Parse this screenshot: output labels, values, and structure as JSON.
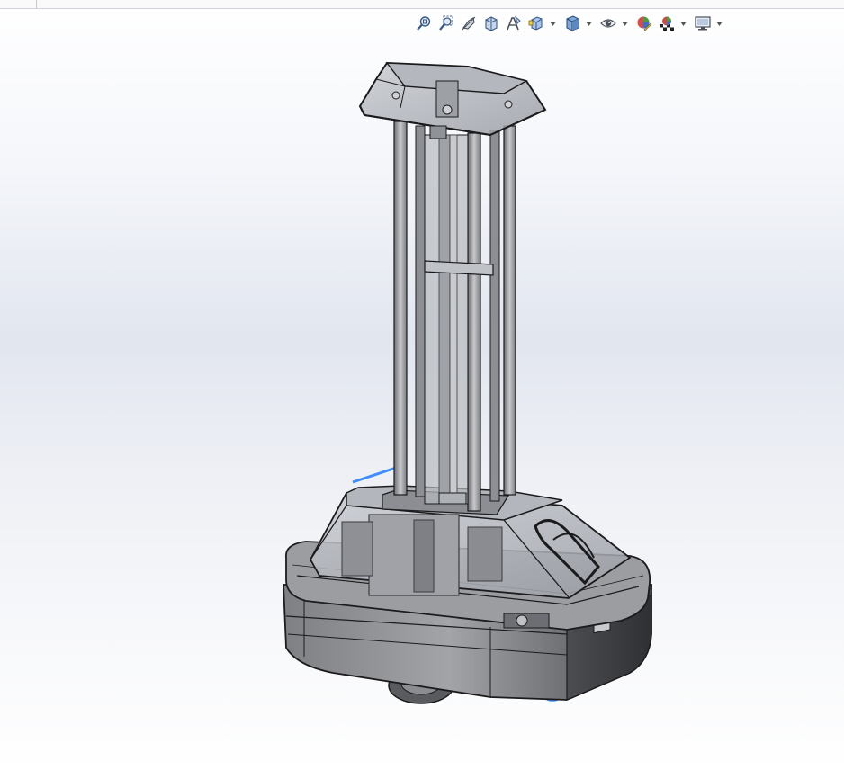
{
  "heads_up_toolbar": {
    "buttons": [
      {
        "icon": "zoom-to-fit-icon"
      },
      {
        "icon": "zoom-to-area-icon"
      },
      {
        "icon": "previous-view-icon"
      },
      {
        "icon": "section-view-icon"
      },
      {
        "icon": "dynamic-annotation-views-icon"
      },
      {
        "icon": "view-orientation-icon",
        "dropdown": true
      },
      {
        "icon": "display-style-icon",
        "dropdown": true
      },
      {
        "icon": "hide-show-items-icon",
        "dropdown": true
      },
      {
        "icon": "edit-appearance-icon"
      },
      {
        "icon": "apply-scene-icon",
        "dropdown": true
      },
      {
        "icon": "view-settings-icon",
        "dropdown": true
      }
    ]
  },
  "colors": {
    "background_top": "#ffffff",
    "background_mid": "#e2e6ef",
    "model_body": "#8f9094",
    "model_dark": "#5d5e62",
    "model_glass": "#b9bcc2",
    "edge_line": "#1b1b1d",
    "selection_highlight": "#3f8cff"
  }
}
